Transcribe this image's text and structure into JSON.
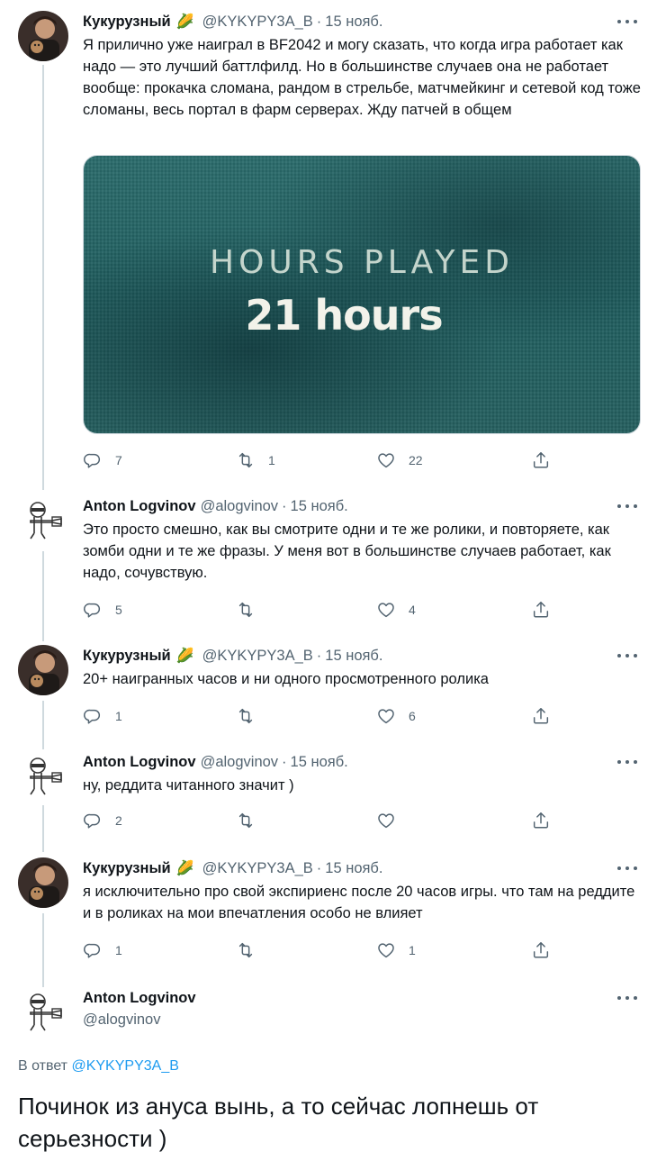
{
  "tweets": [
    {
      "author_name": "Кукурузный",
      "author_emoji": "🌽",
      "handle": "@KYKYPY3A_B",
      "date": "15 нояб.",
      "text": "Я прилично уже наиграл в BF2042 и могу сказать, что когда игра работает как надо — это лучший баттлфилд. Но в большинстве случаев она не работает вообще: прокачка сломана, рандом в стрельбе, матчмейкинг и сетевой код тоже сломаны, весь портал в фарм серверах. Жду патчей в общем",
      "media": {
        "caption": "HOURS PLAYED",
        "value": "21 hours"
      },
      "stats": {
        "replies": "7",
        "retweets": "1",
        "likes": "22"
      }
    },
    {
      "author_name": "Anton Logvinov",
      "handle": "@alogvinov",
      "date": "15 нояб.",
      "text": "Это просто смешно, как вы смотрите одни и те же ролики, и повторяете, как зомби одни и те же фразы. У меня вот в большинстве случаев работает, как надо, сочувствую.",
      "stats": {
        "replies": "5",
        "retweets": "",
        "likes": "4"
      }
    },
    {
      "author_name": "Кукурузный",
      "author_emoji": "🌽",
      "handle": "@KYKYPY3A_B",
      "date": "15 нояб.",
      "text": "20+ наигранных часов и ни одного просмотренного ролика",
      "stats": {
        "replies": "1",
        "retweets": "",
        "likes": "6"
      }
    },
    {
      "author_name": "Anton Logvinov",
      "handle": "@alogvinov",
      "date": "15 нояб.",
      "text": "ну, реддита читанного значит )",
      "stats": {
        "replies": "2",
        "retweets": "",
        "likes": ""
      }
    },
    {
      "author_name": "Кукурузный",
      "author_emoji": "🌽",
      "handle": "@KYKYPY3A_B",
      "date": "15 нояб.",
      "text": "я исключительно про свой экспириенс после 20 часов игры. что там на реддите и в роликах на мои впечатления особо не влияет",
      "stats": {
        "replies": "1",
        "retweets": "",
        "likes": "1"
      }
    }
  ],
  "main_tweet": {
    "author_name": "Anton Logvinov",
    "handle": "@alogvinov",
    "reply_prefix": "В ответ",
    "reply_to": "@KYKYPY3A_B",
    "text": "Починок из ануса вынь, а то сейчас лопнешь от серьезности )"
  },
  "icons": {
    "reply": "reply-icon",
    "retweet": "retweet-icon",
    "like": "heart-icon",
    "share": "share-icon",
    "more": "more-icon"
  },
  "colors": {
    "text": "#0f1419",
    "secondary": "#536471",
    "link": "#1d9bf0",
    "thread_line": "#cfd9de"
  }
}
